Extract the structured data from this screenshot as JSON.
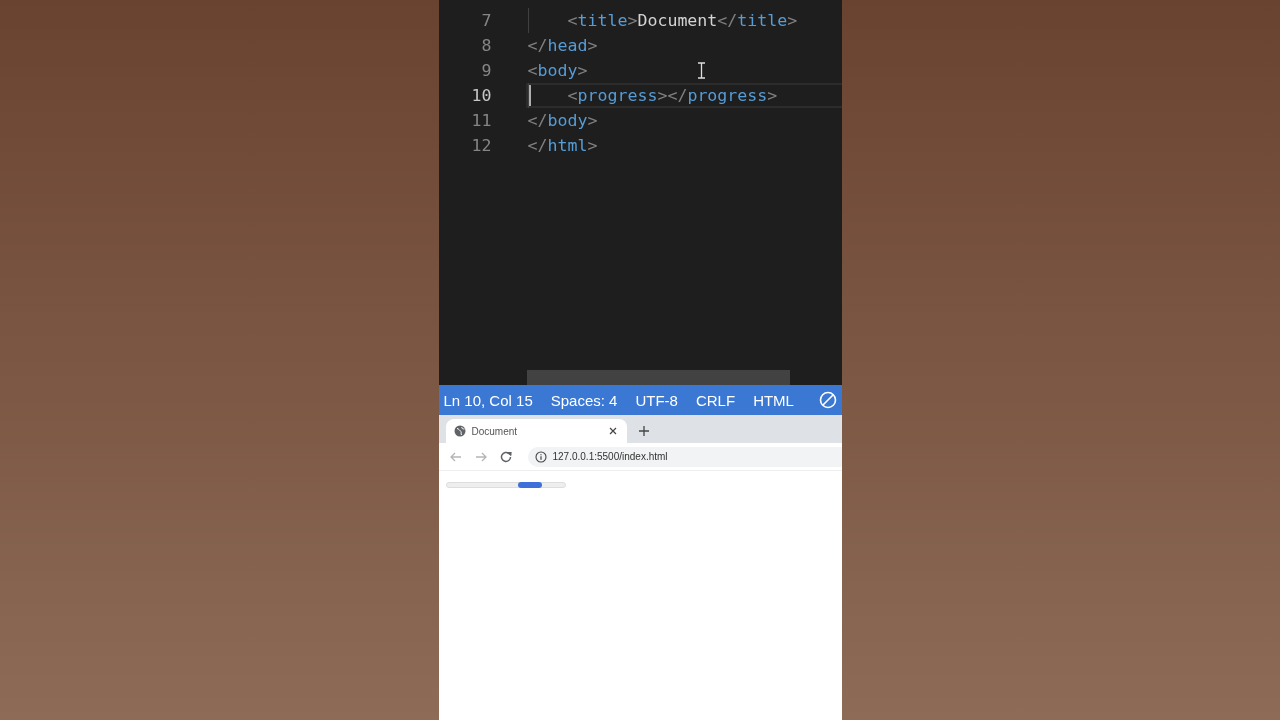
{
  "editor": {
    "lines": [
      {
        "number": "7",
        "text": "    <title>Document</title>",
        "current": false
      },
      {
        "number": "8",
        "text": "</head>",
        "current": false
      },
      {
        "number": "9",
        "text": "<body>",
        "current": false
      },
      {
        "number": "10",
        "text": "    <progress></progress>",
        "current": true
      },
      {
        "number": "11",
        "text": "</body>",
        "current": false
      },
      {
        "number": "12",
        "text": "</html>",
        "current": false
      }
    ]
  },
  "status_bar": {
    "items": [
      "Ln 10, Col 15",
      "Spaces: 4",
      "UTF-8",
      "CRLF",
      "HTML"
    ]
  },
  "browser": {
    "tabs": [
      {
        "title": "Document",
        "selected": true
      }
    ],
    "nav": [
      {
        "kind": "back",
        "disabled": true
      },
      {
        "kind": "forward",
        "disabled": true
      },
      {
        "kind": "reload",
        "disabled": false
      }
    ],
    "url": "127.0.0.1:5500/index.html",
    "progress": {
      "indeterminate": true
    }
  }
}
